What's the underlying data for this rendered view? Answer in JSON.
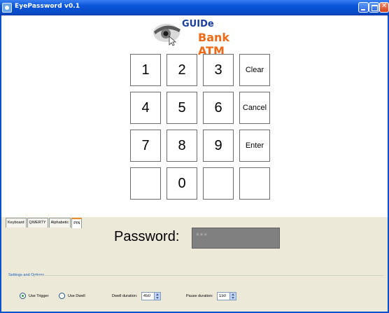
{
  "window": {
    "title": "EyePassword v0.1"
  },
  "logo": {
    "line1": "GUIDe",
    "line2": "Bank ATM"
  },
  "keypad": {
    "keys": [
      "1",
      "2",
      "3",
      "Clear",
      "4",
      "5",
      "6",
      "Cancel",
      "7",
      "8",
      "9",
      "Enter",
      "",
      "0",
      "",
      ""
    ]
  },
  "tabs": [
    "Keyboard",
    "QWERTY",
    "Alphabetic",
    "PIN"
  ],
  "active_tab": "PIN",
  "password": {
    "label": "Password:",
    "value": "***"
  },
  "settings": {
    "title": "Settings and Options",
    "use_trigger": "Use Trigger",
    "use_dwell": "Use Dwell",
    "selected_mode": "Use Trigger",
    "dwell_label": "Dwell duration:",
    "dwell_value": "450",
    "pause_label": "Pause duration:",
    "pause_value": "150"
  },
  "colors": {
    "titlebar": "#0a55d9",
    "logo_guide": "#1b3fa0",
    "logo_bank": "#ef6a16",
    "panel": "#ece9d8"
  }
}
